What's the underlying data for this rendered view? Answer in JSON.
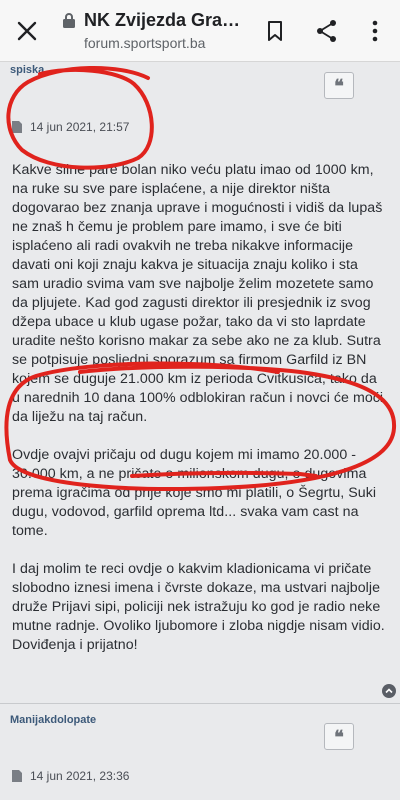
{
  "topbar": {
    "title": "NK Zvijezda Grad…",
    "url": "forum.sportsport.ba"
  },
  "post1": {
    "author": "spiska",
    "quote_label": "❝",
    "date": "14 jun 2021, 21:57",
    "paragraphs": [
      "Kakve silne pare bolan niko veću platu imao od 1000 km, na ruke su sve pare isplaćene, a nije direktor ništa dogovarao bez znanja uprave i mogućnosti i vidiš da lupaš ne znaš h čemu je problem pare imamo, i sve će biti isplaćeno ali radi ovakvih ne treba nikakve informacije davati oni koji znaju kakva je situacija znaju koliko i sta sam uradio svima vam sve najbolje želim mozetete samo da pljujete. Kad god zagusti direktor ili presjednik iz svog džepa ubace u klub ugase požar, tako da vi sto laprdate uradite nešto korisno makar za sebe ako ne za klub. Sutra se potpisuje posljedni sporazum sa firmom Garfild iz BN kojem se duguje 21.000 km iz perioda Cvitkusica, tako da u narednih 10 dana 100% odblokiran račun i novci će moći da liježu na taj račun.",
      "Ovdje ovajvi pričaju od dugu kojem mi imamo 20.000 - 30.000 km, a ne pričate o milionskom dugu, o dugovima prema igračima od prije koje smo mi platili, o Šegrtu, Suki dugu, vodovod, garfild oprema ltd... svaka vam cast na tome.",
      "I daj molim te reci ovdje o kakvim kladionicama vi pričate slobodno iznesi imena i čvrste dokaze, ma ustvari najbolje druže Prijavi sipi, policiji nek istražuju ko god je radio neke mutne radnje. Ovoliko ljubomore i zloba nigdje nisam vidio. Doviđenja i prijatno!"
    ]
  },
  "post2": {
    "author": "Manijakdolopate",
    "quote_label": "❝",
    "date": "14 jun 2021, 23:36"
  },
  "colors": {
    "annotation_red": "#e0231d",
    "author_blue": "#3d5a7a"
  }
}
